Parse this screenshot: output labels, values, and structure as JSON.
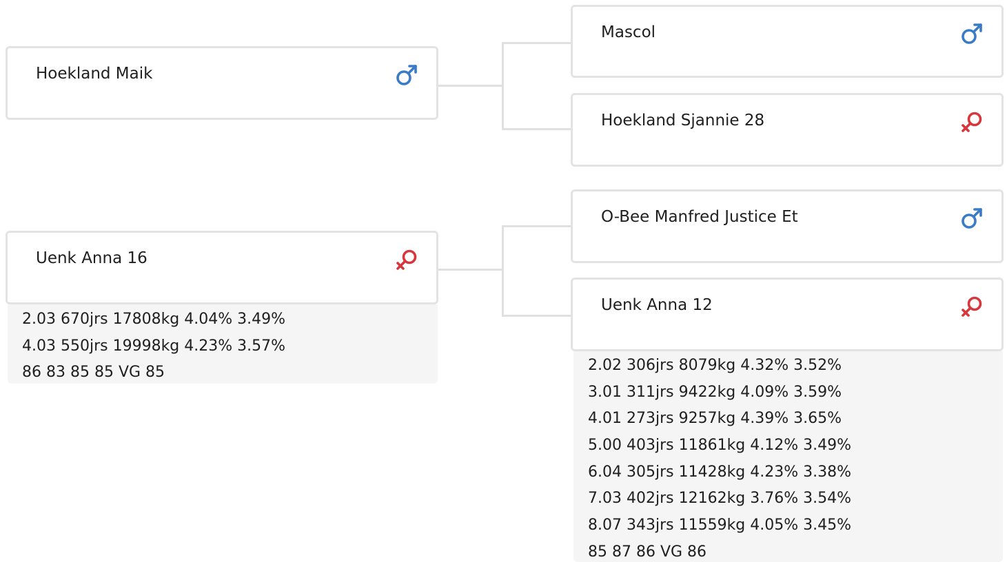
{
  "pedigree": {
    "sire": {
      "name": "Hoekland Maik",
      "sex": "male",
      "sire": {
        "name": "Mascol",
        "sex": "male"
      },
      "dam": {
        "name": "Hoekland Sjannie 28",
        "sex": "female"
      }
    },
    "dam": {
      "name": "Uenk Anna 16",
      "sex": "female",
      "records": [
        "2.03 670jrs 17808kg 4.04% 3.49%",
        "4.03 550jrs 19998kg 4.23% 3.57%",
        "86 83 85 85 VG 85"
      ],
      "sire": {
        "name": "O-Bee Manfred Justice Et",
        "sex": "male"
      },
      "dam": {
        "name": "Uenk Anna 12",
        "sex": "female",
        "records": [
          "2.02 306jrs 8079kg 4.32% 3.52%",
          "3.01 311jrs 9422kg 4.09% 3.59%",
          "4.01 273jrs 9257kg 4.39% 3.65%",
          "5.00 403jrs 11861kg 4.12% 3.49%",
          "6.04 305jrs 11428kg 4.23% 3.38%",
          "7.03 402jrs 12162kg 3.76% 3.54%",
          "8.07 343jrs 11559kg 4.05% 3.45%",
          "85 87 86 VG 86"
        ]
      }
    }
  },
  "icons": {
    "male": "male-symbol-icon",
    "female": "female-symbol-icon"
  },
  "colors": {
    "male": "#3a7bc8",
    "female": "#d7363c",
    "card_border": "#e3e3e3",
    "connector": "#e0e0e0",
    "info_background": "#f5f5f5"
  }
}
